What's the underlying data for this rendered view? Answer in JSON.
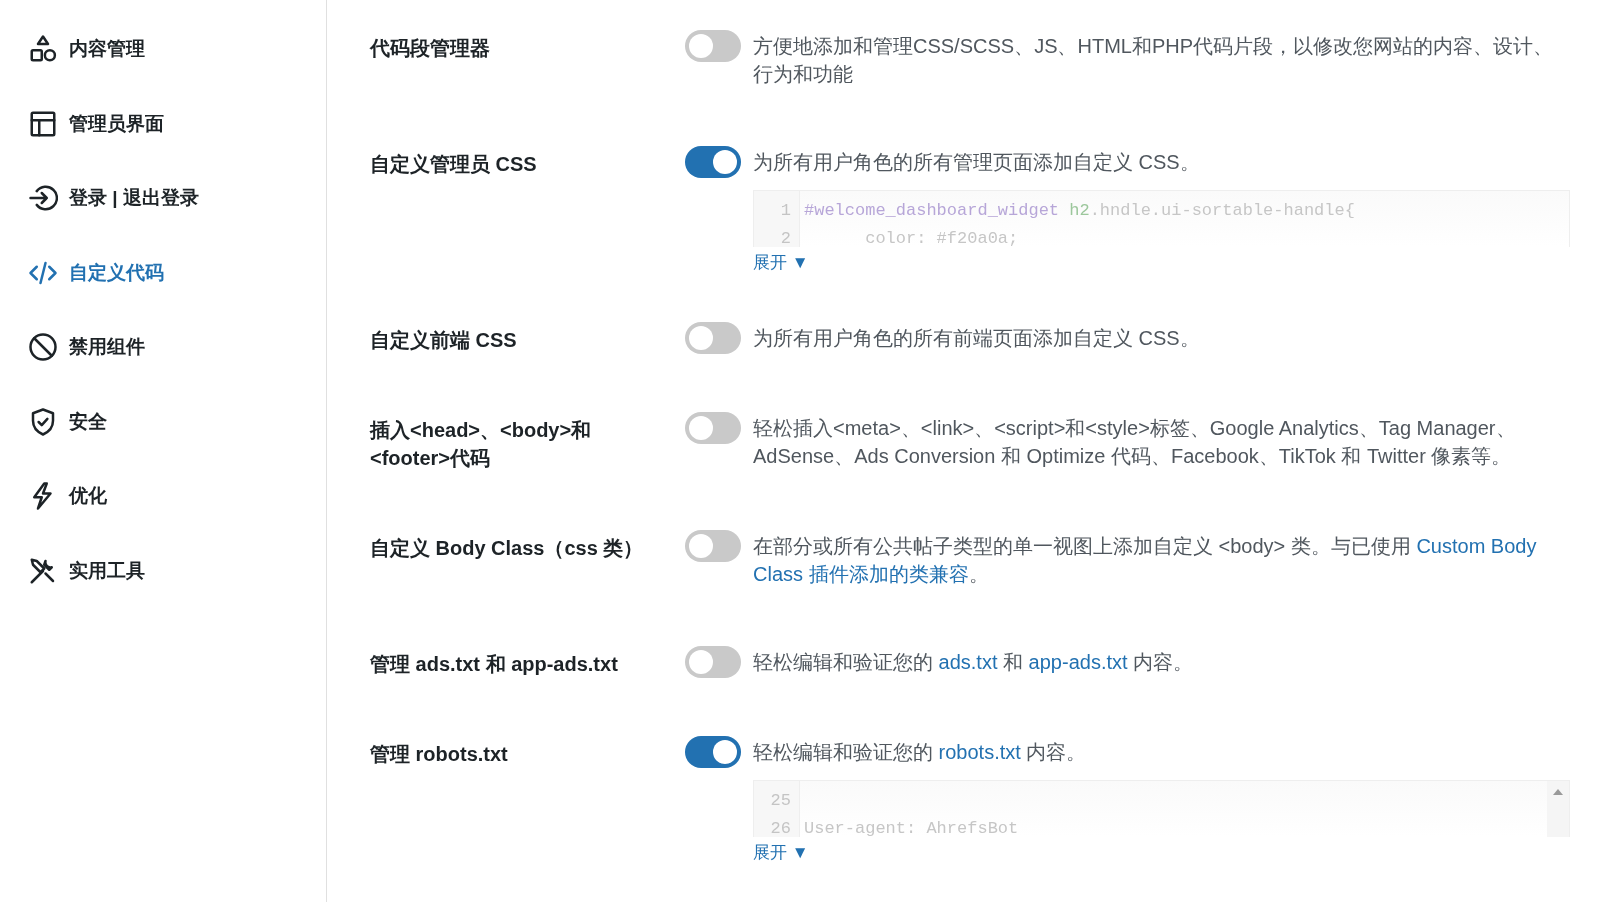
{
  "sidebar": {
    "items": [
      {
        "label": "内容管理",
        "selected": false
      },
      {
        "label": "管理员界面",
        "selected": false
      },
      {
        "label": "登录 | 退出登录",
        "selected": false
      },
      {
        "label": "自定义代码",
        "selected": true
      },
      {
        "label": "禁用组件",
        "selected": false
      },
      {
        "label": "安全",
        "selected": false
      },
      {
        "label": "优化",
        "selected": false
      },
      {
        "label": "实用工具",
        "selected": false
      }
    ]
  },
  "settings": [
    {
      "label": "代码段管理器",
      "on": false,
      "description": [
        {
          "text": "方便地添加和管理CSS/SCSS、JS、HTML和PHP代码片段，以修改您网站的内容、设计、行为和功能"
        }
      ]
    },
    {
      "label": "自定义管理员 CSS",
      "on": true,
      "description": [
        {
          "text": "为所有用户角色的所有管理页面添加自定义 CSS。"
        }
      ],
      "editor": {
        "lines": [
          {
            "number": "1",
            "tokens": [
              {
                "kind": "selector",
                "text": "#welcome_dashboard_widget "
              },
              {
                "kind": "tag",
                "text": "h2"
              },
              {
                "kind": "plain",
                "text": ".hndle.ui-sortable-handle{"
              }
            ]
          },
          {
            "number": "2",
            "tokens": [
              {
                "kind": "plain",
                "text": "      color: #f20a0a;"
              }
            ]
          }
        ],
        "expand": "展开 ▼"
      }
    },
    {
      "label": "自定义前端 CSS",
      "on": false,
      "description": [
        {
          "text": "为所有用户角色的所有前端页面添加自定义 CSS。"
        }
      ]
    },
    {
      "label": "插入<head>、<body>和<footer>代码",
      "on": false,
      "description": [
        {
          "text": "轻松插入<meta>、<link>、<script>和<style>标签、Google Analytics、Tag Manager、AdSense、Ads Conversion 和 Optimize 代码、Facebook、TikTok 和 Twitter 像素等。"
        }
      ]
    },
    {
      "label": "自定义 Body Class（css 类）",
      "on": false,
      "description": [
        {
          "text": "在部分或所有公共帖子类型的单一视图上添加自定义 <body> 类。与已使用 "
        },
        {
          "text": "Custom Body ",
          "link": true
        },
        {
          "text": "Class 插件添加的类兼容",
          "link": true
        },
        {
          "text": "。"
        }
      ]
    },
    {
      "label": "管理 ads.txt 和 app-ads.txt",
      "on": false,
      "description": [
        {
          "text": "轻松编辑和验证您的 "
        },
        {
          "text": "ads.txt",
          "link": true
        },
        {
          "text": " 和 "
        },
        {
          "text": "app-ads.txt",
          "link": true
        },
        {
          "text": " 内容。"
        }
      ]
    },
    {
      "label": "管理 robots.txt",
      "on": true,
      "description": [
        {
          "text": "轻松编辑和验证您的 "
        },
        {
          "text": "robots.txt",
          "link": true
        },
        {
          "text": " 内容。"
        }
      ],
      "editor": {
        "lines": [
          {
            "number": "25"
          },
          {
            "number": "26",
            "tokens": [
              {
                "kind": "plain",
                "text": "User-agent: AhrefsBot"
              }
            ]
          }
        ],
        "scrollbar": true,
        "expand": "展开 ▼"
      }
    }
  ]
}
